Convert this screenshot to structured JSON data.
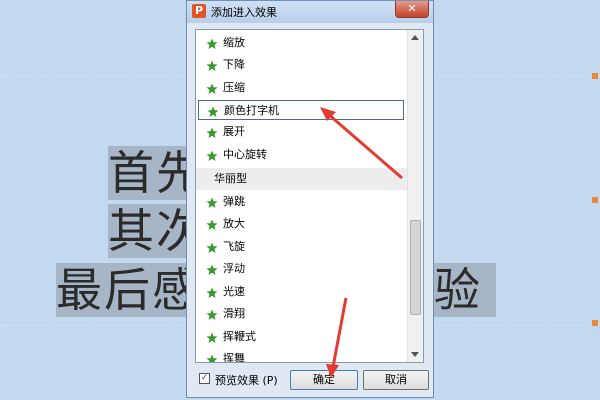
{
  "dialog": {
    "title": "添加进入效果",
    "app_icon": "P",
    "close_glyph": "✕",
    "items": [
      {
        "label": "缩放"
      },
      {
        "label": "下降"
      },
      {
        "label": "压缩"
      },
      {
        "label": "颜色打字机",
        "selected": true
      },
      {
        "label": "展开"
      },
      {
        "label": "中心旋转"
      }
    ],
    "category": "华丽型",
    "items2": [
      {
        "label": "弹跳"
      },
      {
        "label": "放大"
      },
      {
        "label": "飞旋"
      },
      {
        "label": "浮动"
      },
      {
        "label": "光速"
      },
      {
        "label": "滑翔"
      },
      {
        "label": "挥鞭式"
      },
      {
        "label": "挥舞"
      }
    ],
    "preview_label": "预览效果 (P)",
    "preview_checked": true,
    "ok_label": "确定",
    "cancel_label": "取消"
  },
  "slide": {
    "line1": "首先",
    "line2": "其次",
    "line3": "最后感",
    "line3_end": "验"
  },
  "colors": {
    "accent_arrow": "#e23b2f",
    "star_icon": "#3a9a2d"
  }
}
